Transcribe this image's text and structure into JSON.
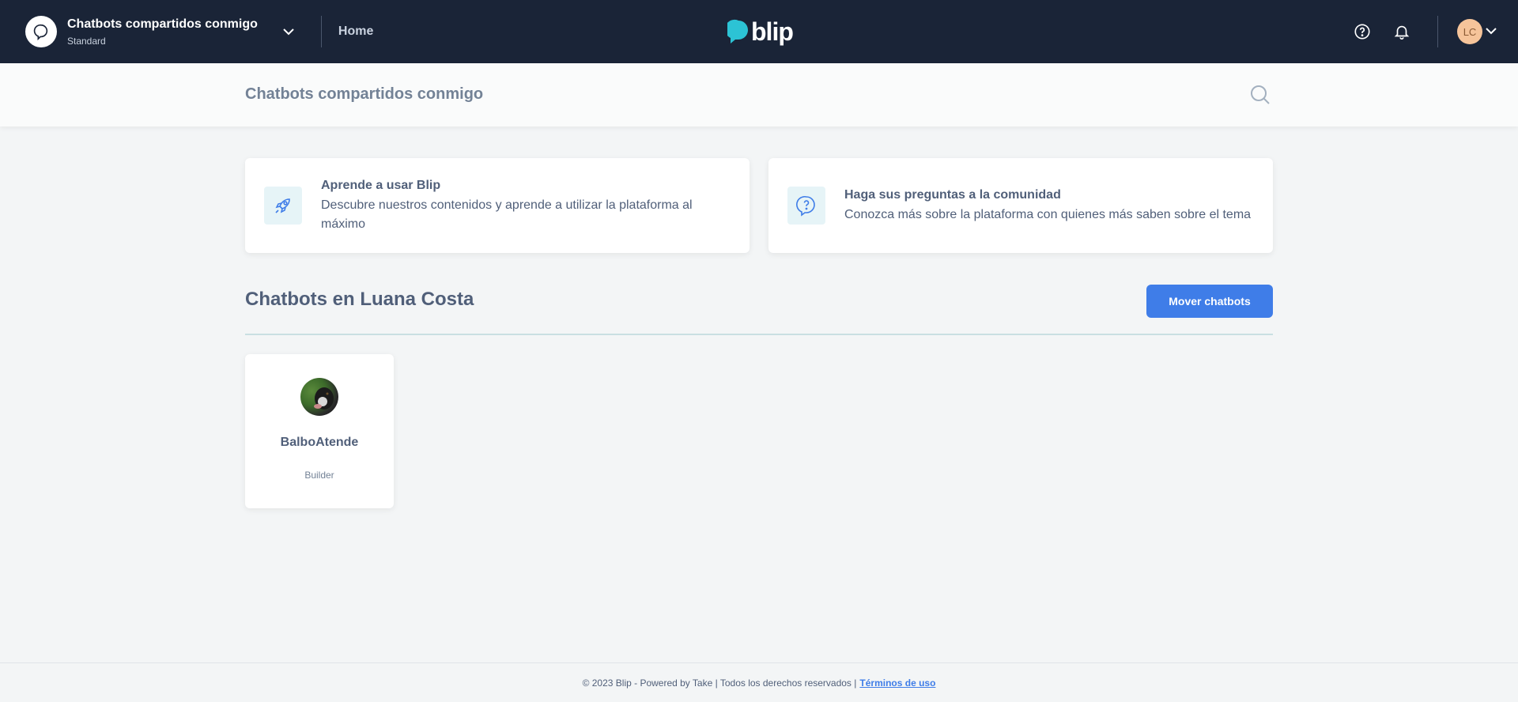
{
  "header": {
    "tenant_name": "Chatbots compartidos conmigo",
    "tenant_plan": "Standard",
    "nav_home": "Home",
    "logo_text": "blip",
    "user_initials": "LC"
  },
  "subheader": {
    "title": "Chatbots compartidos conmigo"
  },
  "info_cards": [
    {
      "title": "Aprende a usar Blip",
      "description": "Descubre nuestros contenidos y aprende a utilizar la plataforma al máximo",
      "icon": "rocket-icon"
    },
    {
      "title": "Haga sus preguntas a la comunidad",
      "description": "Conozca más sobre la plataforma con quienes más saben sobre el tema",
      "icon": "question-chat-icon"
    }
  ],
  "section": {
    "title": "Chatbots en Luana Costa",
    "move_button": "Mover chatbots"
  },
  "bots": [
    {
      "name": "BalboAtende",
      "role": "Builder"
    }
  ],
  "footer": {
    "text": "© 2023 Blip - Powered by Take | Todos los derechos reservados |",
    "terms_link": "Términos de uso"
  },
  "colors": {
    "topbar": "#1a2437",
    "accent": "#3f7de8",
    "logo": "#2cc3d5",
    "background": "#f3f5f6"
  }
}
